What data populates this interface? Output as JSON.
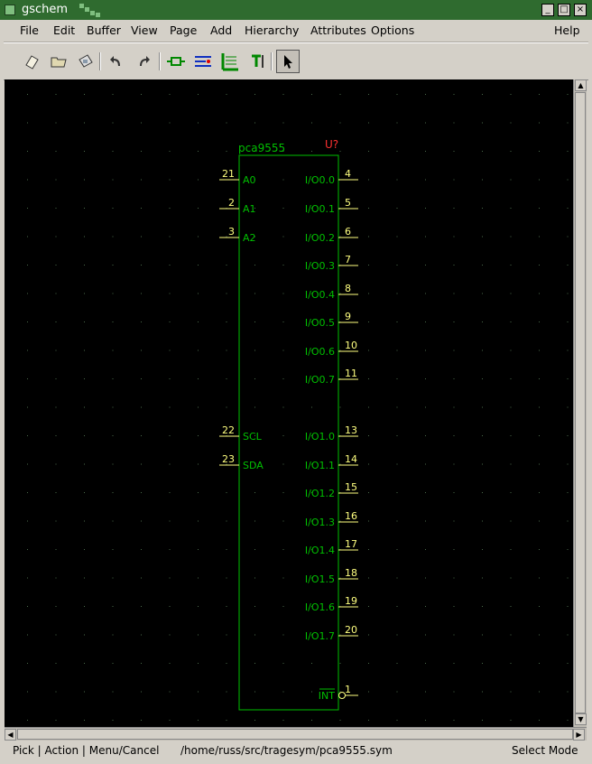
{
  "window": {
    "title": "gschem"
  },
  "menu": [
    "File",
    "Edit",
    "Buffer",
    "View",
    "Page",
    "Add",
    "Hierarchy",
    "Attributes",
    "Options",
    "Help"
  ],
  "toolbar": {
    "icons": [
      "new-file-icon",
      "open-file-icon",
      "save-file-icon",
      "undo-icon",
      "redo-icon",
      "add-component-icon",
      "add-net-icon",
      "add-bus-icon",
      "add-text-icon",
      "select-arrow-icon"
    ],
    "active": "select-arrow-icon"
  },
  "symbol": {
    "name": "pca9555",
    "refdes": "U?",
    "left_pins": [
      {
        "num": "21",
        "label": "A0"
      },
      {
        "num": "2",
        "label": "A1"
      },
      {
        "num": "3",
        "label": "A2"
      },
      {
        "num": "22",
        "label": "SCL"
      },
      {
        "num": "23",
        "label": "SDA"
      }
    ],
    "right_pins": [
      {
        "num": "4",
        "label": "I/O0.0"
      },
      {
        "num": "5",
        "label": "I/O0.1"
      },
      {
        "num": "6",
        "label": "I/O0.2"
      },
      {
        "num": "7",
        "label": "I/O0.3"
      },
      {
        "num": "8",
        "label": "I/O0.4"
      },
      {
        "num": "9",
        "label": "I/O0.5"
      },
      {
        "num": "10",
        "label": "I/O0.6"
      },
      {
        "num": "11",
        "label": "I/O0.7"
      },
      {
        "num": "13",
        "label": "I/O1.0"
      },
      {
        "num": "14",
        "label": "I/O1.1"
      },
      {
        "num": "15",
        "label": "I/O1.2"
      },
      {
        "num": "16",
        "label": "I/O1.3"
      },
      {
        "num": "17",
        "label": "I/O1.4"
      },
      {
        "num": "18",
        "label": "I/O1.5"
      },
      {
        "num": "19",
        "label": "I/O1.6"
      },
      {
        "num": "20",
        "label": "I/O1.7"
      },
      {
        "num": "1",
        "label": "INT"
      }
    ]
  },
  "colors": {
    "grid": "#4a6a4a",
    "symbol": "#00c000",
    "pin": "#ffff80",
    "refdes": "#ff3030"
  },
  "status": {
    "mouse": "Pick | Action | Menu/Cancel",
    "file": "/home/russ/src/tragesym/pca9555.sym",
    "mode": "Select Mode"
  }
}
